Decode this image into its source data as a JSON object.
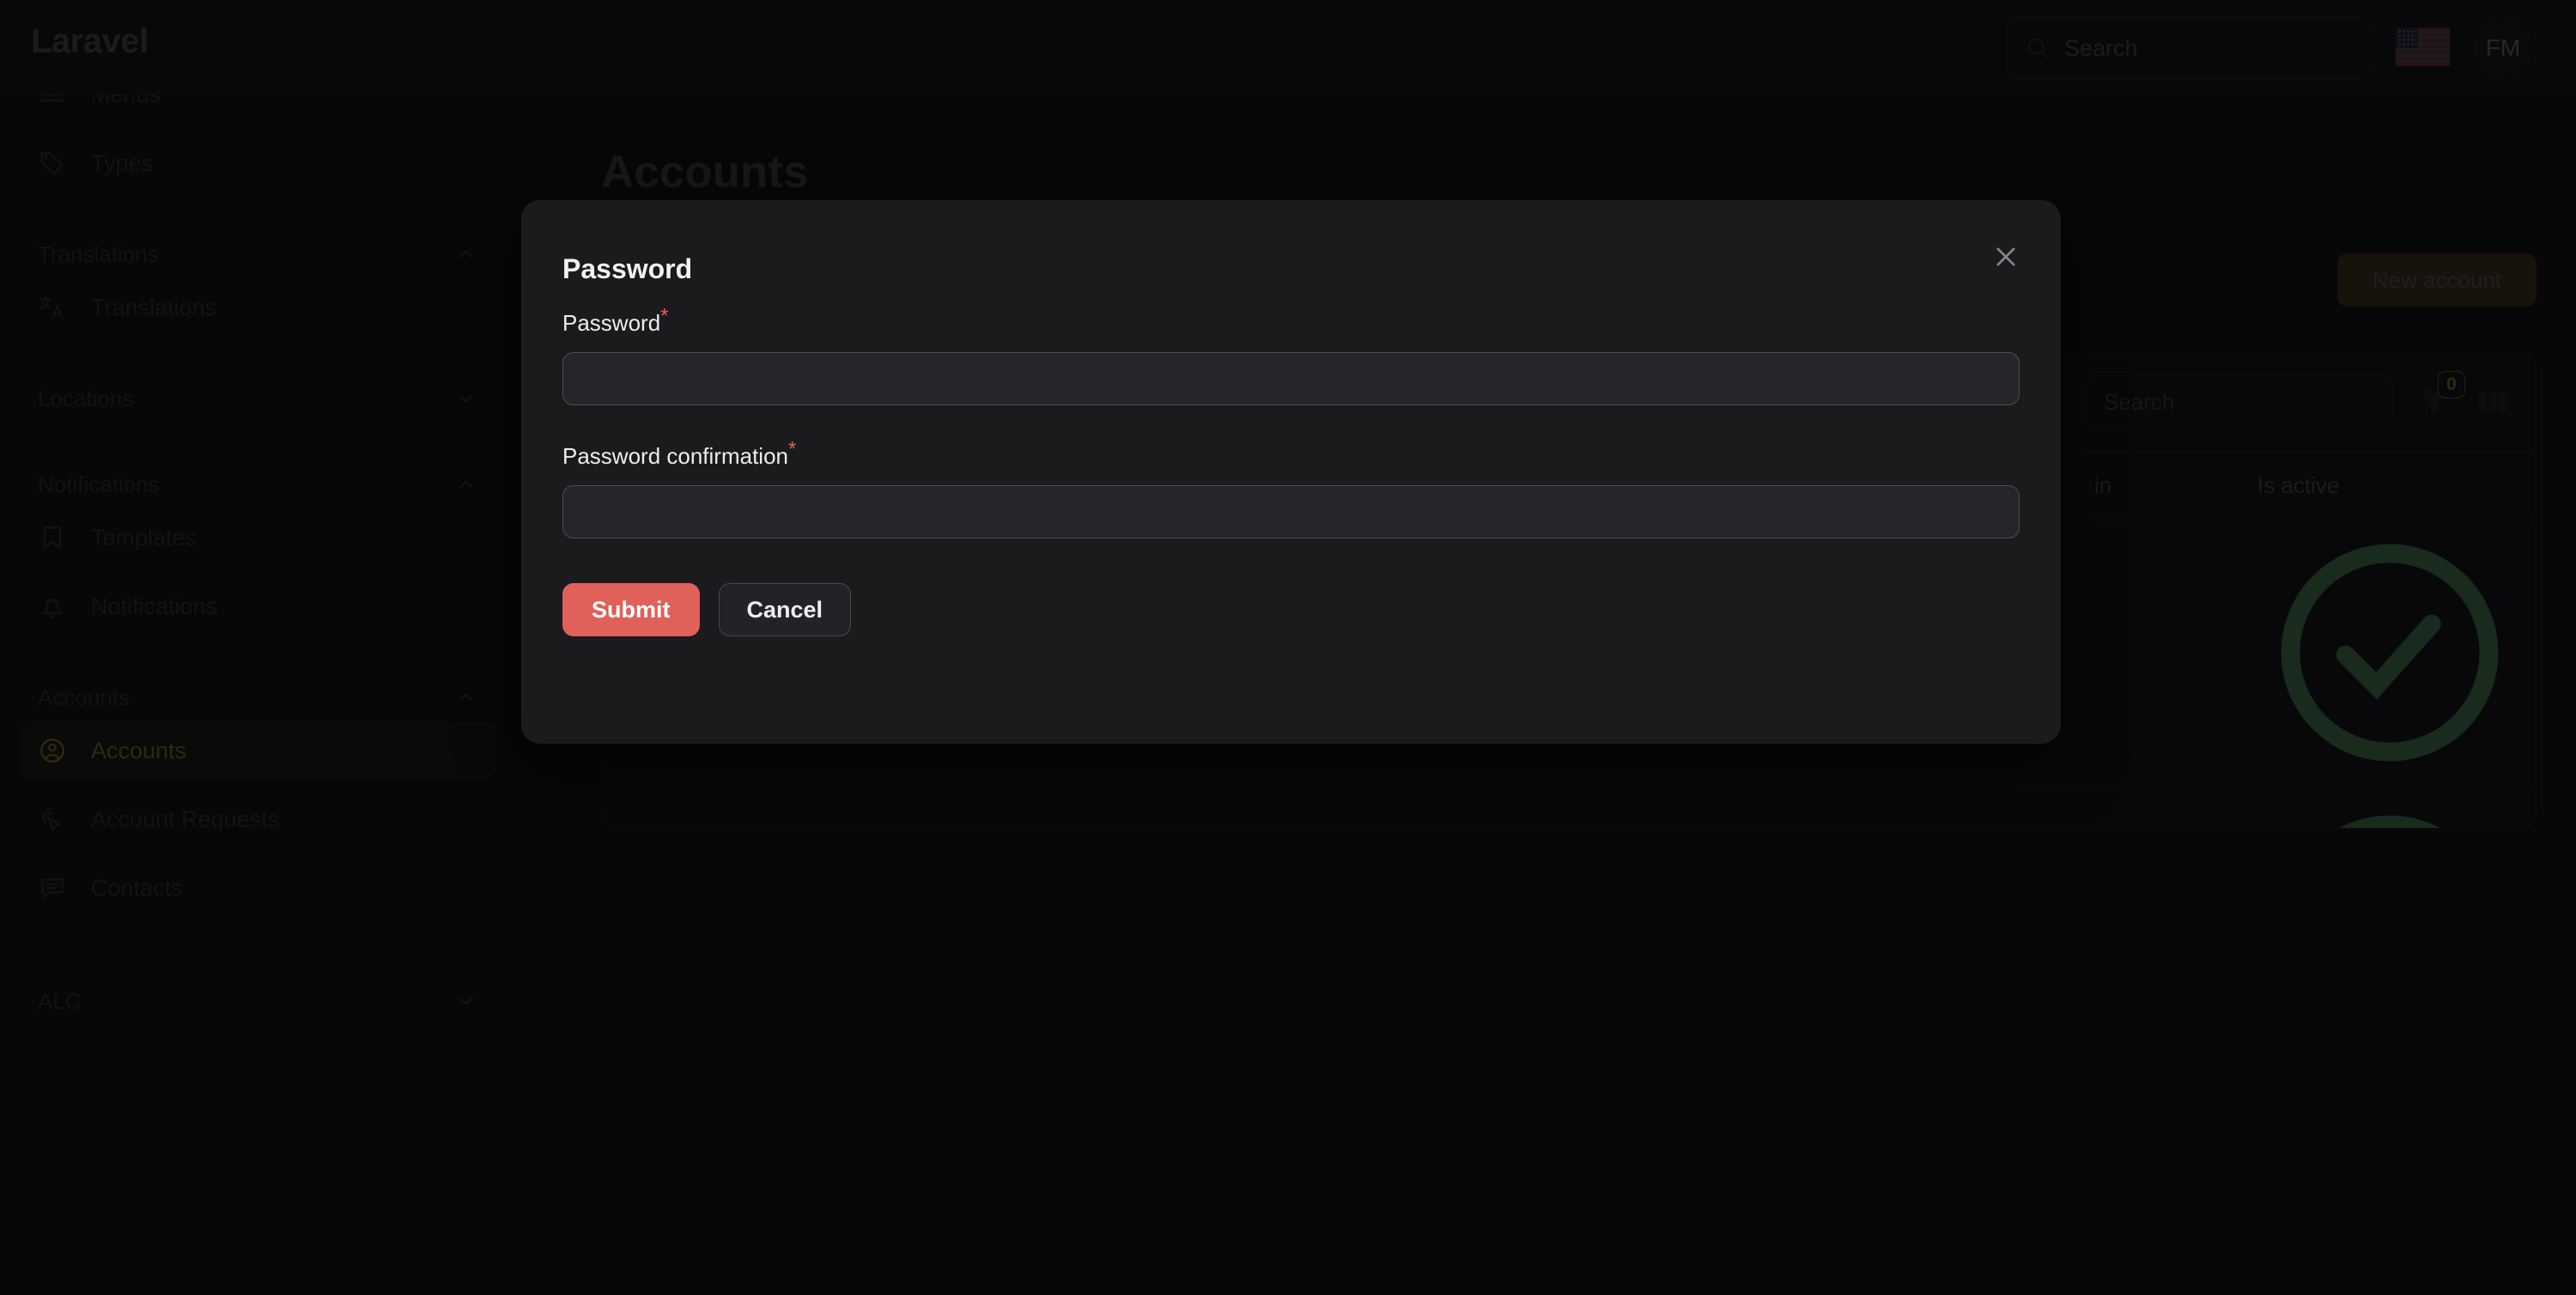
{
  "app": {
    "brand": "Laravel"
  },
  "topbar": {
    "search_placeholder": "Search",
    "search_value": "",
    "flag_name": "united-states-flag",
    "avatar_initials": "FM"
  },
  "sidebar": {
    "items": [
      {
        "label": "Menus",
        "icon": "menu-icon",
        "type": "item",
        "active": false
      },
      {
        "label": "Types",
        "icon": "tag-icon",
        "type": "item",
        "active": false
      },
      {
        "label": "Translations",
        "icon": "chevron-up-icon",
        "type": "section",
        "expanded": true
      },
      {
        "label": "Translations",
        "icon": "language-icon",
        "type": "item",
        "active": false
      },
      {
        "label": "Locations",
        "icon": "chevron-down-icon",
        "type": "section",
        "expanded": false
      },
      {
        "label": "Notifications",
        "icon": "chevron-up-icon",
        "type": "section",
        "expanded": true
      },
      {
        "label": "Templates",
        "icon": "bookmark-icon",
        "type": "item",
        "active": false
      },
      {
        "label": "Notifications",
        "icon": "bell-icon",
        "type": "item",
        "active": false
      },
      {
        "label": "Accounts",
        "icon": "chevron-up-icon",
        "type": "section",
        "expanded": true
      },
      {
        "label": "Accounts",
        "icon": "user-circle-icon",
        "type": "item",
        "active": true
      },
      {
        "label": "Account Requests",
        "icon": "cursor-click-icon",
        "type": "item",
        "active": false
      },
      {
        "label": "Contacts",
        "icon": "chat-icon",
        "type": "item",
        "active": false
      },
      {
        "label": "ALC",
        "icon": "chevron-down-icon",
        "type": "section",
        "expanded": false
      }
    ]
  },
  "main": {
    "page_title": "Accounts",
    "new_button": "New account",
    "table_search_placeholder": "Search",
    "filter_badge_count": "0",
    "columns": [
      "",
      "in",
      "Is active",
      ""
    ],
    "rows": [
      {
        "active": true,
        "actions": [
          "lock-icon",
          "bell-icon",
          "edit-icon",
          "trash-icon"
        ]
      },
      {
        "active": true,
        "actions": [
          "lock-icon",
          "bell-icon",
          "edit-icon",
          "trash-icon"
        ]
      }
    ]
  },
  "modal": {
    "title": "Password",
    "close_icon": "close-icon",
    "fields": [
      {
        "label": "Password",
        "required": "*",
        "value": "",
        "placeholder": ""
      },
      {
        "label": "Password confirmation",
        "required": "*",
        "value": "",
        "placeholder": ""
      }
    ],
    "submit_label": "Submit",
    "cancel_label": "Cancel"
  },
  "colors": {
    "accent_amber": "#8a6d21",
    "submit_red": "#e0605a",
    "required_red": "#e0605a",
    "success_green": "#3f7a4a",
    "page_bg": "#0a0a0b",
    "modal_bg": "#1b1b1e"
  }
}
